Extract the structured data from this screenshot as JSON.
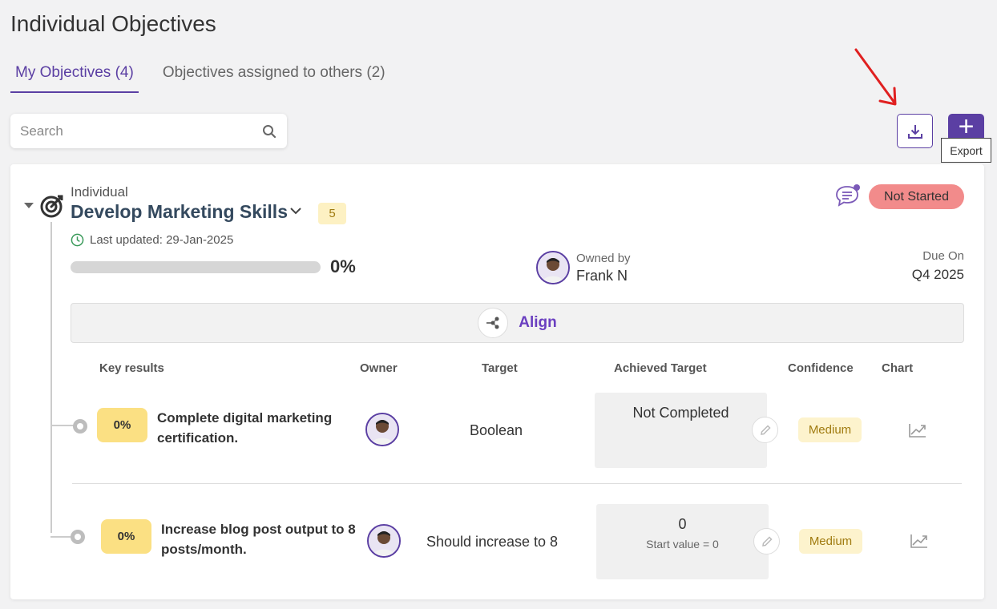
{
  "page": {
    "title": "Individual Objectives"
  },
  "tabs": [
    {
      "label": "My Objectives (4)",
      "active": true
    },
    {
      "label": "Objectives assigned to others (2)",
      "active": false
    }
  ],
  "search": {
    "placeholder": "Search",
    "value": ""
  },
  "toolbar": {
    "export_tooltip": "Export",
    "add_label": "+"
  },
  "objective": {
    "type": "Individual",
    "title": "Develop Marketing Skills",
    "kr_count": "5",
    "last_updated": "Last updated: 29-Jan-2025",
    "progress_text": "0%",
    "progress_value": 0,
    "owned_by_label": "Owned by",
    "owner_name": "Frank N",
    "status": "Not Started",
    "due_label": "Due On",
    "due_value": "Q4 2025",
    "align_label": "Align"
  },
  "key_results_table": {
    "headers": {
      "key_results": "Key results",
      "owner": "Owner",
      "target": "Target",
      "achieved": "Achieved Target",
      "confidence": "Confidence",
      "chart": "Chart"
    },
    "rows": [
      {
        "pct": "0%",
        "title": "Complete digital marketing certification.",
        "target": "Boolean",
        "achieved_main": "Not Completed",
        "achieved_sub": "",
        "confidence": "Medium"
      },
      {
        "pct": "0%",
        "title": "Increase blog post output to 8 posts/month.",
        "target": "Should increase to 8",
        "achieved_main": "0",
        "achieved_sub": "Start value = 0",
        "confidence": "Medium"
      }
    ]
  },
  "colors": {
    "accent": "#5b3fa3",
    "status_not_started": "#f28b8b",
    "confidence_medium": "#fdf3cd",
    "kr_pct": "#fbe083",
    "annotation_arrow": "#e02020"
  },
  "icons": [
    "search-icon",
    "download-icon",
    "plus-icon",
    "target-icon",
    "chevron-down-icon",
    "clock-icon",
    "chat-icon",
    "align-icon",
    "edit-icon",
    "chart-icon"
  ]
}
